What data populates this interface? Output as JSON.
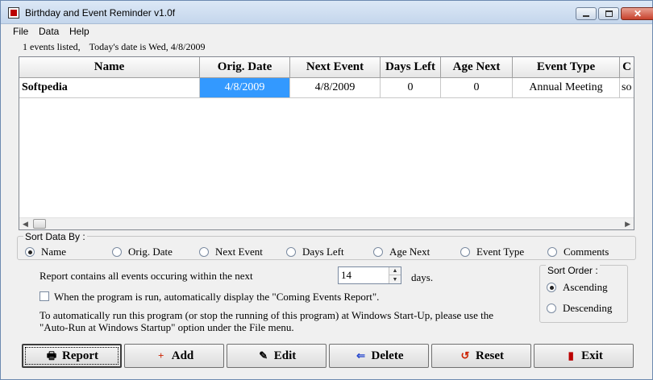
{
  "window": {
    "title": "Birthday and Event Reminder v1.0f",
    "close_glyph": "✕"
  },
  "menu": {
    "items": [
      "File",
      "Data",
      "Help"
    ]
  },
  "status": {
    "events_listed": "1 events listed,",
    "today": "Today's date is Wed, 4/8/2009"
  },
  "table": {
    "columns": [
      "Name",
      "Orig. Date",
      "Next Event",
      "Days Left",
      "Age Next",
      "Event Type",
      "C"
    ],
    "rows": [
      [
        "Softpedia",
        "4/8/2009",
        "4/8/2009",
        "0",
        "0",
        "Annual Meeting",
        "so"
      ]
    ]
  },
  "sort_by": {
    "legend": "Sort Data By :",
    "options": [
      "Name",
      "Orig. Date",
      "Next Event",
      "Days Left",
      "Age Next",
      "Event Type",
      "Comments"
    ],
    "selected": "Name"
  },
  "report": {
    "prefix": "Report contains all events occuring within the next",
    "days_value": "14",
    "suffix": "days.",
    "autodisplay_label": "When the program is run, automatically display the \"Coming Events Report\".",
    "autodisplay_checked": false,
    "autorun_line1": "To automatically run this program (or stop the running of this program) at Windows Start-Up, please use the",
    "autorun_line2": "\"Auto-Run at Windows Startup\" option under the File menu."
  },
  "sort_order": {
    "legend": "Sort Order :",
    "options": [
      "Ascending",
      "Descending"
    ],
    "selected": "Ascending"
  },
  "buttons": [
    {
      "label": "Report",
      "icon": "report-icon"
    },
    {
      "label": "Add",
      "icon": "add-icon"
    },
    {
      "label": "Edit",
      "icon": "edit-icon"
    },
    {
      "label": "Delete",
      "icon": "delete-icon"
    },
    {
      "label": "Reset",
      "icon": "reset-icon"
    },
    {
      "label": "Exit",
      "icon": "exit-icon"
    }
  ],
  "colors": {
    "selection": "#3399ff",
    "reset_icon": "#cc2200",
    "add_icon": "#cc2200",
    "delete_icon": "#2244cc"
  }
}
